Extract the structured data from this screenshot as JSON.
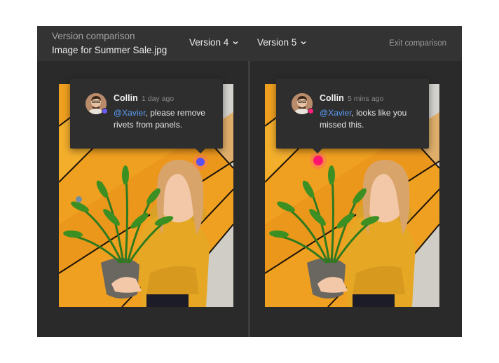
{
  "header": {
    "title": "Version comparison",
    "filename": "Image for Summer Sale.jpg",
    "left_version": "Version 4",
    "right_version": "Version 5",
    "exit_label": "Exit comparison"
  },
  "panels": [
    {
      "version": "Version 4",
      "comment": {
        "author": "Collin",
        "time": "1 day ago",
        "mention": "@Xavier",
        "text": ", please remove rivets from panels.",
        "status_color": "#6b5cf6"
      },
      "pin_color": "#5a4ff0"
    },
    {
      "version": "Version 5",
      "comment": {
        "author": "Collin",
        "time": "5 mins ago",
        "mention": "@Xavier",
        "text": ", looks like you missed this.",
        "status_color": "#ff1f7a"
      },
      "pin_color": "#ff1470"
    }
  ],
  "colors": {
    "accent_blue": "#5b9cf5",
    "background_orange": "#f0a020",
    "sweater_yellow": "#e6a824"
  },
  "icons": [
    "chevron-down-icon",
    "comment-pin",
    "avatar"
  ]
}
